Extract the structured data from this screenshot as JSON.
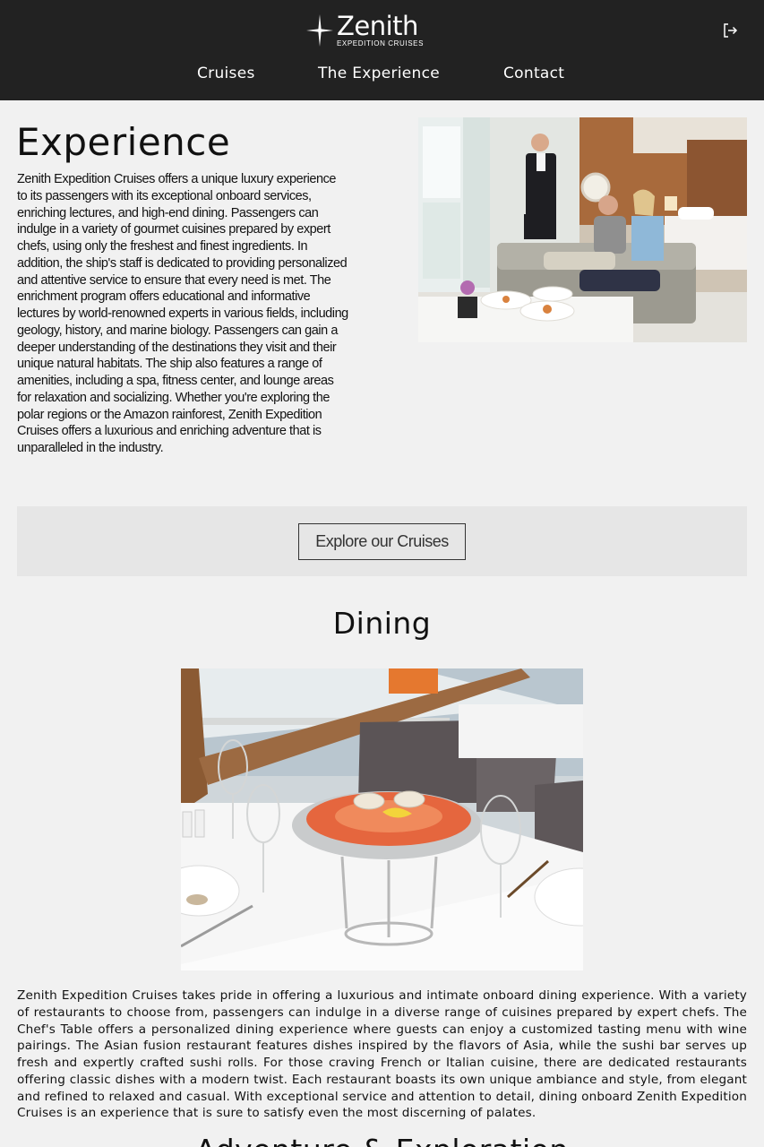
{
  "brand": {
    "name": "Zenith",
    "tagline": "EXPEDITION CRUISES"
  },
  "nav": {
    "items": [
      {
        "label": "Cruises"
      },
      {
        "label": "The Experience"
      },
      {
        "label": "Contact"
      }
    ]
  },
  "header": {
    "login_icon": "login-icon"
  },
  "experience": {
    "heading": "Experience",
    "body": "Zenith Expedition Cruises offers a unique luxury experience to its passengers with its exceptional onboard services, enriching lectures, and high-end dining. Passengers can indulge in a variety of gourmet cuisines prepared by expert chefs, using only the freshest and finest ingredients. In addition, the ship's staff is dedicated to providing personalized and attentive service to ensure that every need is met. The enrichment program offers educational and informative lectures by world-renowned experts in various fields, including geology, history, and marine biology. Passengers can gain a deeper understanding of the destinations they visit and their unique natural habitats. The ship also features a range of amenities, including a spa, fitness center, and lounge areas for relaxation and socializing. Whether you're exploring the polar regions or the Amazon rainforest, Zenith Expedition Cruises offers a luxurious and enriching adventure that is unparalleled in the industry."
  },
  "cta": {
    "label": "Explore our Cruises"
  },
  "dining": {
    "heading": "Dining",
    "body": "Zenith Expedition Cruises takes pride in offering a luxurious and intimate onboard dining experience. With a variety of restaurants to choose from, passengers can indulge in a diverse range of cuisines prepared by expert chefs. The Chef's Table offers a personalized dining experience where guests can enjoy a customized tasting menu with wine pairings. The Asian fusion restaurant features dishes inspired by the flavors of Asia, while the sushi bar serves up fresh and expertly crafted sushi rolls. For those craving French or Italian cuisine, there are dedicated restaurants offering classic dishes with a modern twist. Each restaurant boasts its own unique ambiance and style, from elegant and refined to relaxed and casual. With exceptional service and attention to detail, dining onboard Zenith Expedition Cruises is an experience that is sure to satisfy even the most discerning of palates."
  },
  "next_section": {
    "heading": "Adventure & Exploration"
  },
  "colors": {
    "header_bg": "#222222",
    "page_bg": "#f1f1f1",
    "cta_band_bg": "#e6e6e6",
    "text": "#111111"
  }
}
